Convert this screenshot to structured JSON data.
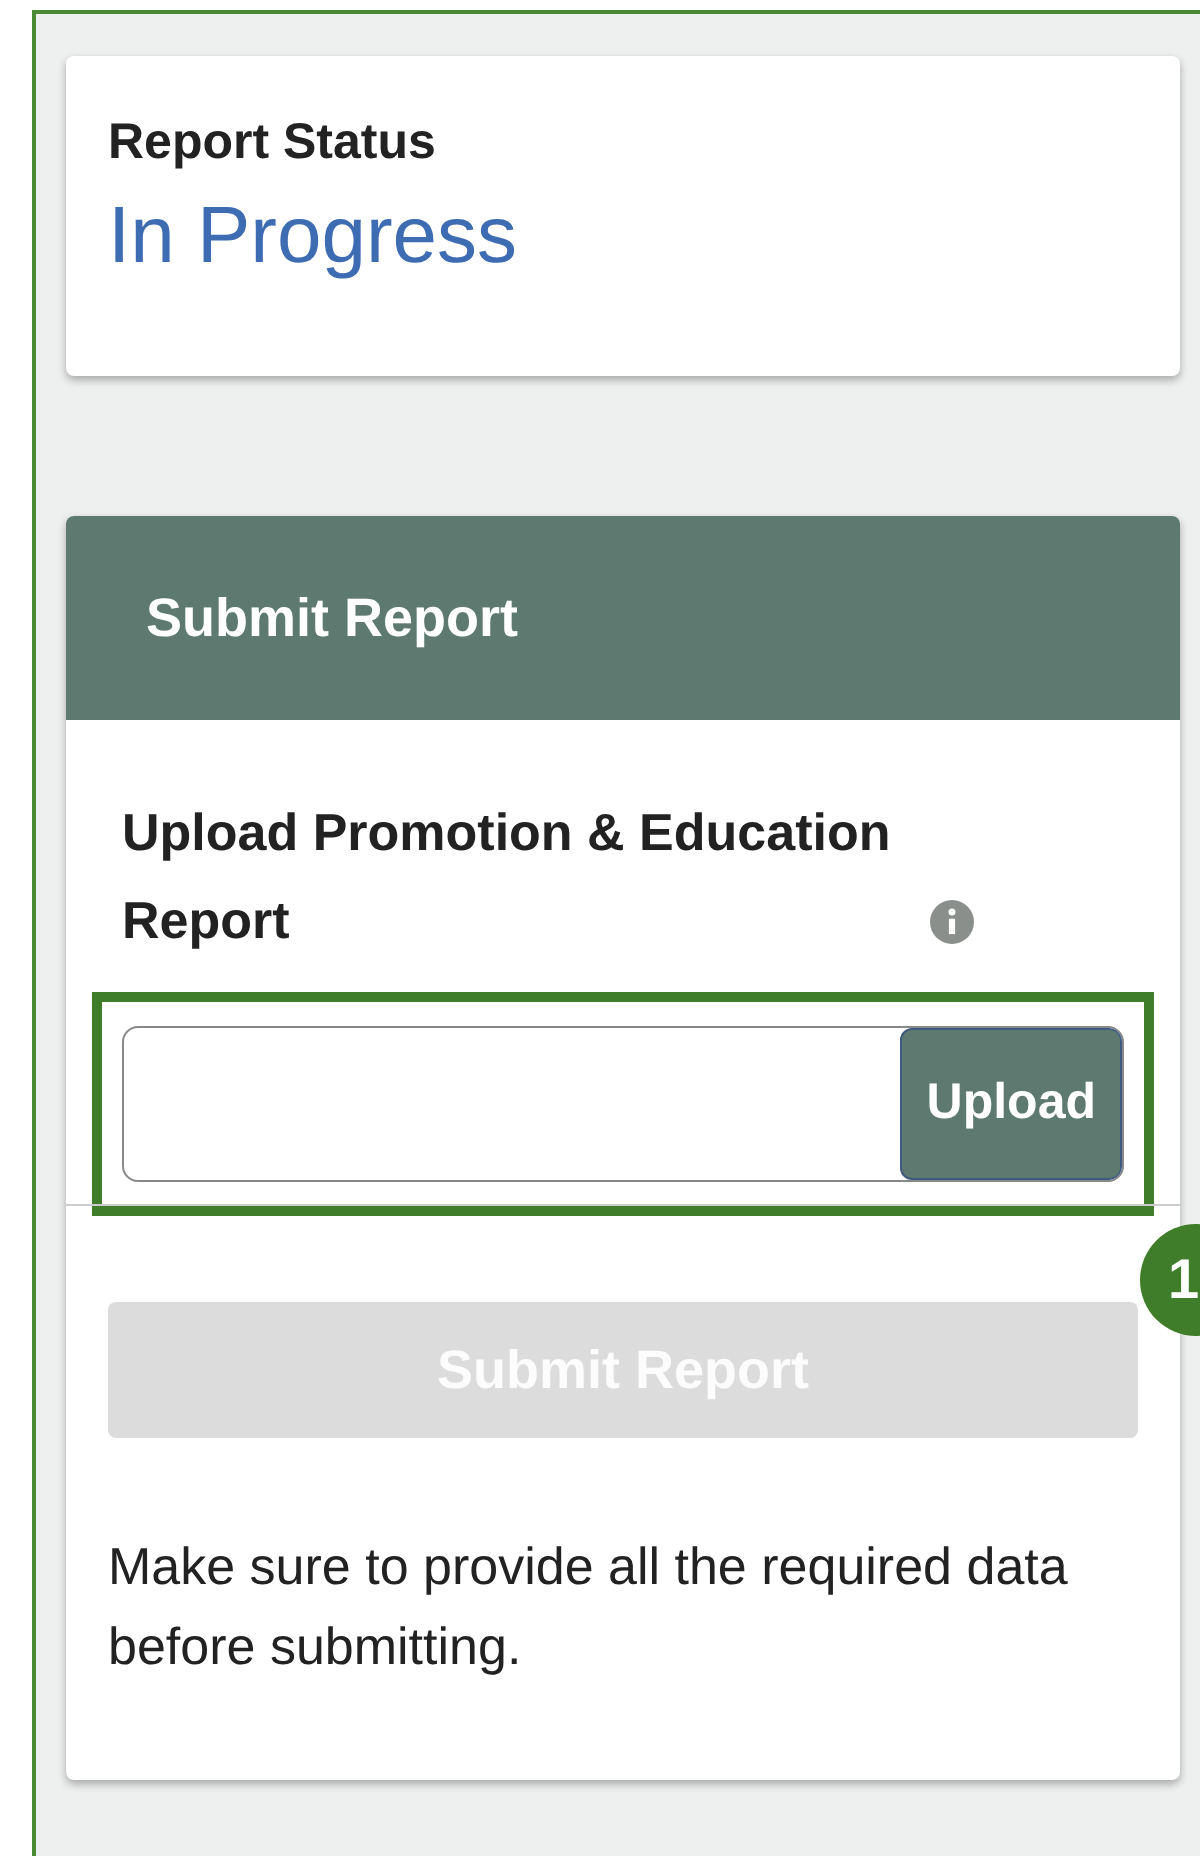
{
  "status_card": {
    "label": "Report Status",
    "value": "In Progress"
  },
  "submit_panel": {
    "title": "Submit Report",
    "upload_label": "Upload Promotion & Education Report",
    "upload_button": "Upload",
    "callout": "1",
    "submit_button": {
      "label": "Submit Report",
      "disabled": true
    },
    "note": "Make sure to provide all the required data before submitting."
  }
}
